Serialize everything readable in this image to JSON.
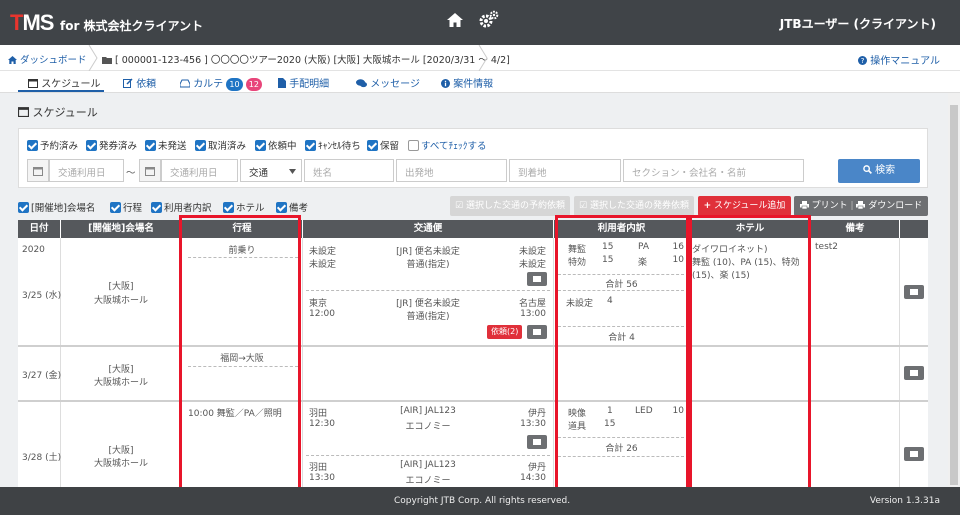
{
  "header": {
    "logo": "TMS",
    "logo_sub": "for 株式会社クライアント",
    "user": "JTBユーザー (クライアント)"
  },
  "breadcrumb": {
    "home": "ダッシュボード",
    "project": "[ 000001-123-456 ]  〇〇〇〇ツアー2020 (大阪)  [大阪] 大阪城ホール [2020/3/31 ～ 4/2]",
    "manual": "操作マニュアル"
  },
  "tabs": [
    {
      "label": "スケジュール"
    },
    {
      "label": "依頼"
    },
    {
      "label": "カルテ",
      "badge1": "10",
      "badge2": "12"
    },
    {
      "label": "手配明細"
    },
    {
      "label": "メッセージ"
    },
    {
      "label": "案件情報"
    }
  ],
  "section_title": "スケジュール",
  "filters": {
    "checks": [
      {
        "label": "予約済み",
        "checked": true
      },
      {
        "label": "発券済み",
        "checked": true
      },
      {
        "label": "未発送",
        "checked": true
      },
      {
        "label": "取消済み",
        "checked": true
      },
      {
        "label": "依頼中",
        "checked": true
      },
      {
        "label": "ｷｬﾝｾﾙ待ち",
        "checked": true
      },
      {
        "label": "保留",
        "checked": true
      },
      {
        "label": "すべてﾁｪｯｸする",
        "checked": false
      }
    ],
    "date_from_placeholder": "交通利用日",
    "tilde": "～",
    "date_to_placeholder": "交通利用日",
    "transport_select": "交通",
    "name_placeholder": "姓名",
    "from_placeholder": "出発地",
    "to_placeholder": "到着地",
    "section_placeholder": "セクション・会社名・名前",
    "search_label": "検索"
  },
  "columns_bar": {
    "checks": [
      {
        "label": "[開催地]会場名"
      },
      {
        "label": "行程"
      },
      {
        "label": "利用者内訳"
      },
      {
        "label": "ホテル"
      },
      {
        "label": "備考"
      }
    ],
    "btn_reserve": "選択した交通の予約依頼",
    "btn_issue": "選択した交通の発券依頼",
    "btn_add": "スケジュール追加",
    "btn_print": "プリント",
    "btn_download": "ダウンロード"
  },
  "grid": {
    "headers": [
      "日付",
      "[開催地]会場名",
      "行程",
      "交通便",
      "利用者内訳",
      "ホテル",
      "備考"
    ],
    "year": "2020",
    "rows": [
      {
        "date": "3/25 (水)",
        "venue1": "[大阪]",
        "venue2": "大阪城ホール",
        "itinerary": "前乗り",
        "t1_a": "未設定",
        "t1_b": "[JR] 便名未設定",
        "t1_c": "未設定",
        "t1_d": "未設定",
        "t1_e": "普通(指定)",
        "t1_f": "未設定",
        "t2_a": "東京",
        "t2_b": "[JR] 便名未設定",
        "t2_c": "名古屋",
        "t2_d": "12:00",
        "t2_e": "普通(指定)",
        "t2_f": "13:00",
        "irai": "依頼(2)",
        "u1_a": "舞監",
        "u1_b": "15",
        "u1_c": "PA",
        "u1_d": "16",
        "u1_e": "特効",
        "u1_f": "15",
        "u1_g": "楽",
        "u1_h": "10",
        "u1_total": "合計 56",
        "u2_a": "未設定",
        "u2_b": "4",
        "u2_total": "合計 4",
        "hotel1": "ダイワロイネット)",
        "hotel2": "舞監 (10)、PA (15)、特効",
        "hotel3": "(15)、楽 (15)",
        "note": "test2"
      },
      {
        "date": "3/27 (金)",
        "venue1": "[大阪]",
        "venue2": "大阪城ホール",
        "itinerary": "福岡→大阪"
      },
      {
        "date": "3/28 (土)",
        "venue1": "[大阪]",
        "venue2": "大阪城ホール",
        "itinerary": "10:00 舞監／PA／照明",
        "t1_a": "羽田",
        "t1_b": "[AIR] JAL123",
        "t1_c": "伊丹",
        "t1_d": "12:30",
        "t1_e": "エコノミー",
        "t1_f": "13:30",
        "t2_a": "羽田",
        "t2_b": "[AIR] JAL123",
        "t2_c": "伊丹",
        "t2_d": "13:30",
        "t2_e": "エコノミー",
        "t2_f": "14:30",
        "u1_a": "映像",
        "u1_b": "1",
        "u1_c": "LED",
        "u1_d": "10",
        "u1_e": "道具",
        "u1_f": "15",
        "u1_total": "合計 26"
      }
    ]
  },
  "footer": {
    "copyright": "Copyright JTB Corp. All rights reserved.",
    "version": "Version 1.3.31a"
  },
  "colors": {
    "topbar": "#404448",
    "accent": "#1f74c4",
    "danger": "#e0303a",
    "highlight": "#e8152a"
  }
}
